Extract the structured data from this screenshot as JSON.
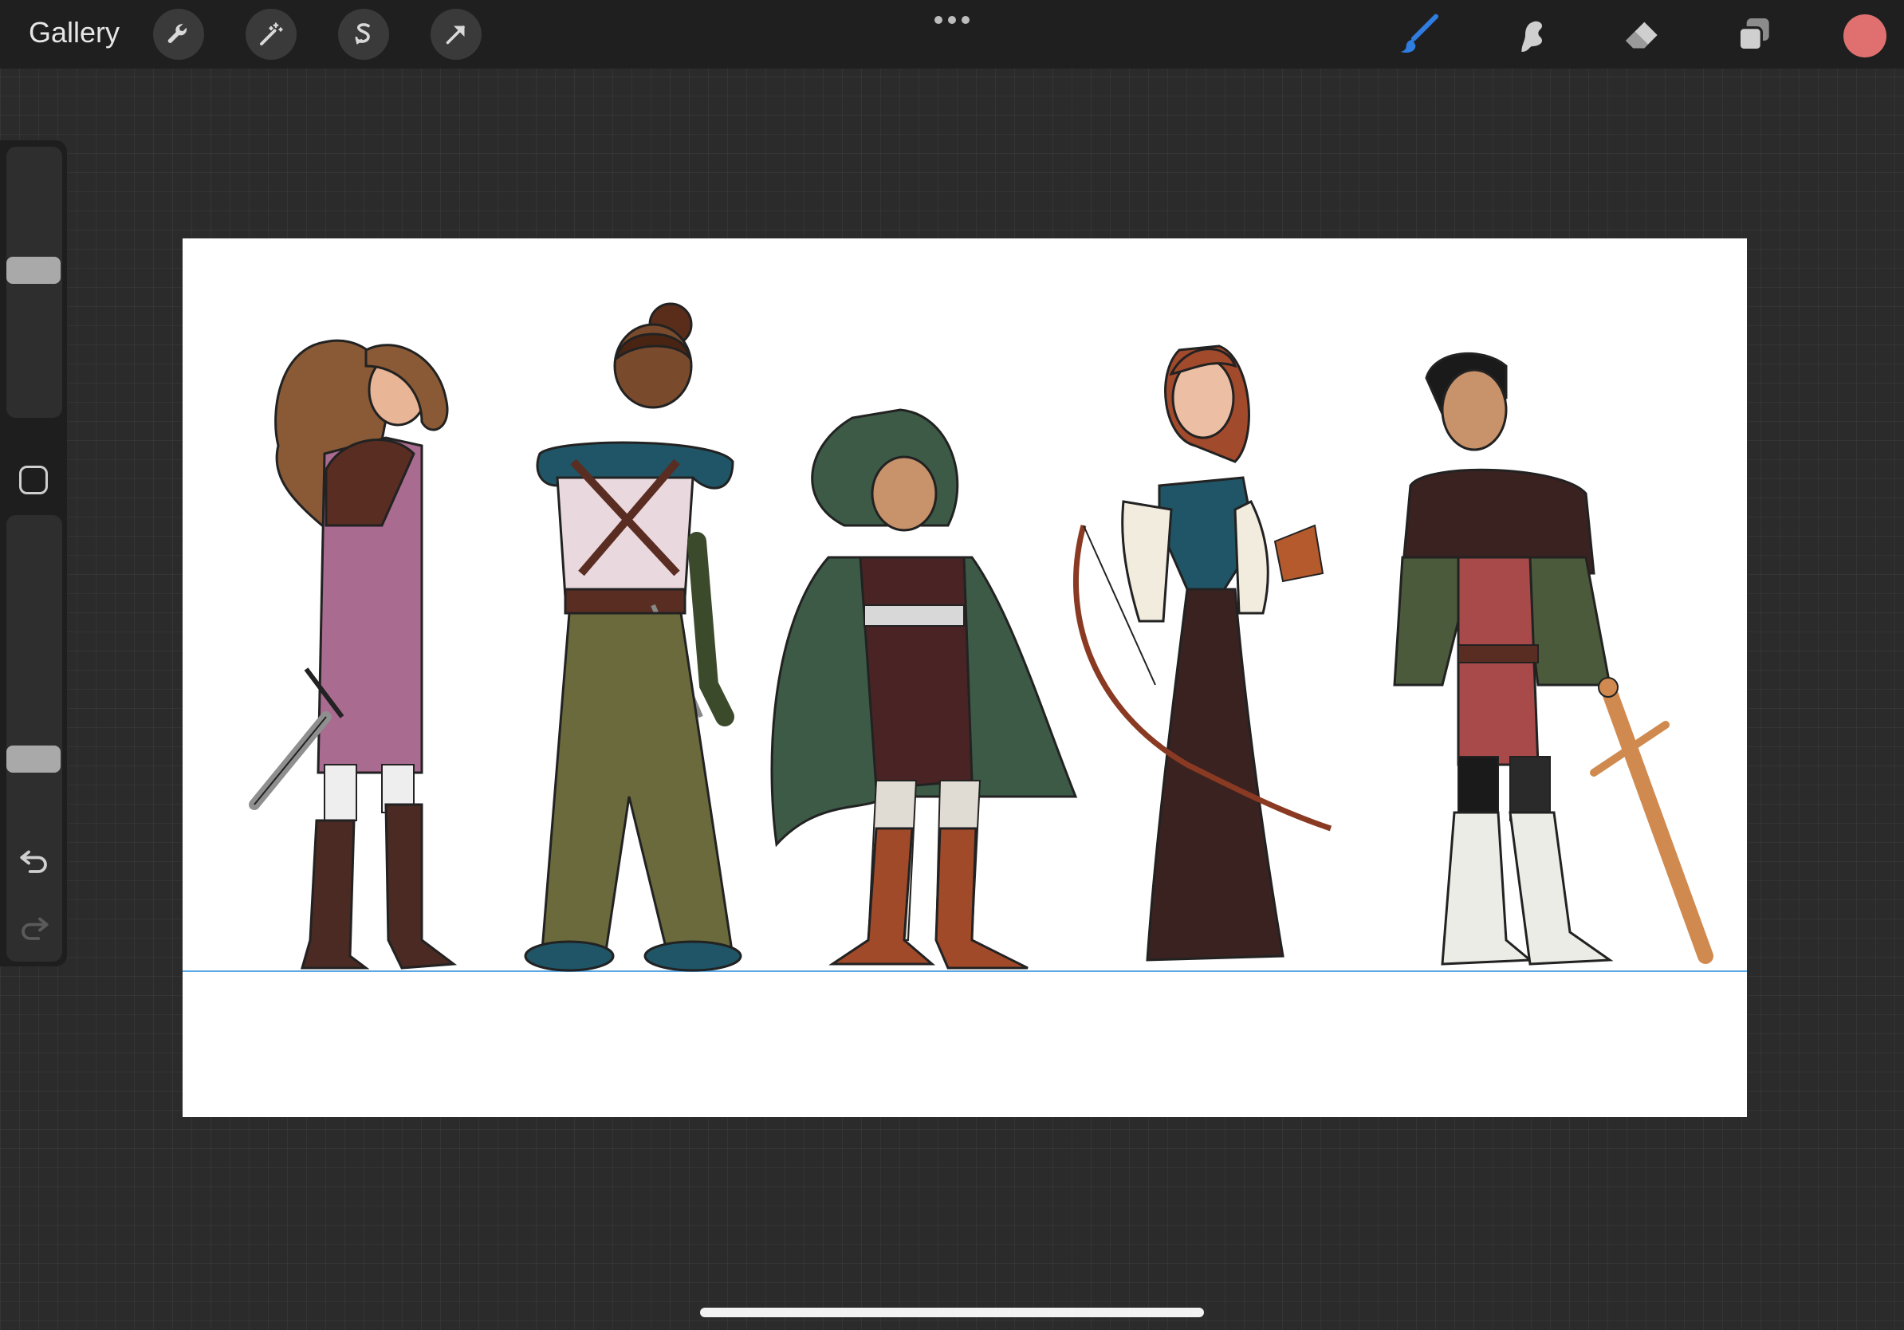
{
  "toolbar": {
    "gallery_label": "Gallery",
    "left_tools": [
      "wrench-icon",
      "magic-wand-icon",
      "selection-icon",
      "transform-arrow-icon"
    ],
    "right_tools": [
      "brush-icon",
      "smudge-icon",
      "eraser-icon",
      "layers-icon"
    ],
    "active_tool": "brush",
    "accent_color": "#2f7de1",
    "current_color": "#e07070"
  },
  "sidebar": {
    "brush_size_level": 0.55,
    "opacity_level": 0.45,
    "undo_icon": "undo-icon",
    "redo_icon": "redo-icon"
  },
  "canvas": {
    "background": "#ffffff",
    "guide_line_color": "#5aa9e6",
    "characters": [
      {
        "name": "long-haired-swordswoman",
        "dress_color": "#a96b8f"
      },
      {
        "name": "ranger-with-bun",
        "pants_color": "#6b6a3c"
      },
      {
        "name": "hooded-figure",
        "cloak_color": "#3c5a46"
      },
      {
        "name": "archer-in-gown",
        "dress_color": "#3a2220"
      },
      {
        "name": "short-haired-knight",
        "sword_color": "#d08a4f"
      }
    ]
  }
}
